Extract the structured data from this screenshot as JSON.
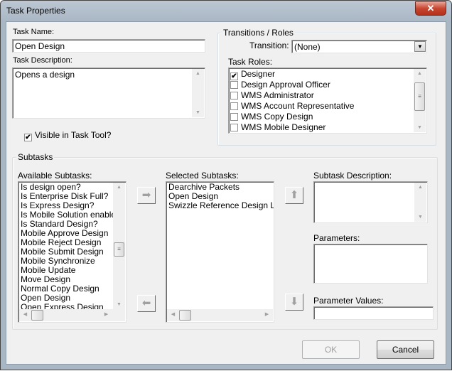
{
  "window": {
    "title": "Task Properties",
    "close_icon": "close-icon"
  },
  "task": {
    "name_label": "Task Name:",
    "name_value": "Open Design",
    "desc_label": "Task Description:",
    "desc_value": "Opens a design",
    "visible_label": "Visible in Task Tool?",
    "visible_checked": true
  },
  "transitions": {
    "legend": "Transitions / Roles",
    "transition_label": "Transition:",
    "transition_value": "(None)",
    "roles_label": "Task Roles:",
    "roles": [
      {
        "label": "Designer",
        "checked": true
      },
      {
        "label": "Design Approval Officer",
        "checked": false
      },
      {
        "label": "WMS Administrator",
        "checked": false
      },
      {
        "label": "WMS Account Representative",
        "checked": false
      },
      {
        "label": "WMS Copy Design",
        "checked": false
      },
      {
        "label": "WMS Mobile Designer",
        "checked": false
      }
    ]
  },
  "subtasks": {
    "legend": "Subtasks",
    "available_label": "Available Subtasks:",
    "available": [
      "Is design open?",
      "Is Enterprise Disk Full?",
      "Is Express Design?",
      "Is Mobile Solution enabled?",
      "Is Standard Design?",
      "Mobile Approve Design",
      "Mobile Reject Design",
      "Mobile Submit Design",
      "Mobile Synchronize",
      "Mobile Update",
      "Move Design",
      "Normal Copy Design",
      "Open Design",
      "Open Express Design"
    ],
    "selected_label": "Selected Subtasks:",
    "selected": [
      "Dearchive Packets",
      "Open Design",
      "Swizzle Reference Design Layers"
    ],
    "description_label": "Subtask Description:",
    "parameters_label": "Parameters:",
    "parameter_values_label": "Parameter Values:"
  },
  "buttons": {
    "ok": "OK",
    "cancel": "Cancel",
    "ok_enabled": false
  }
}
